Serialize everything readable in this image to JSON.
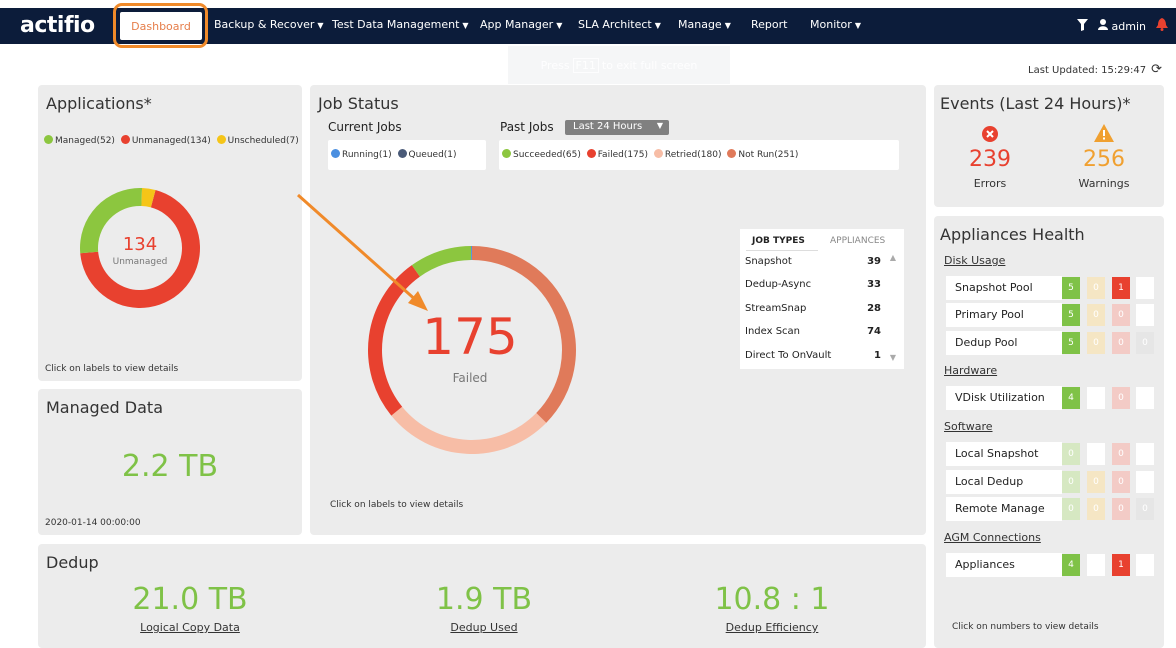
{
  "nav": {
    "logo": "actifio",
    "items": {
      "dashboard": "Dashboard",
      "backup": "Backup & Recover",
      "tdm": "Test Data Management",
      "app_manager": "App Manager",
      "sla": "SLA Architect",
      "manage": "Manage",
      "report": "Report",
      "monitor": "Monitor"
    },
    "user": "admin"
  },
  "fullscreen_tip": {
    "pre": "Press",
    "key": "F11",
    "post": "to exit full screen"
  },
  "last_updated": "Last Updated: 15:29:47",
  "applications": {
    "title": "Applications*",
    "legend": [
      {
        "label": "Managed(52)",
        "color": "#8cc63f"
      },
      {
        "label": "Unmanaged(134)",
        "color": "#e8412f"
      },
      {
        "label": "Unscheduled(7)",
        "color": "#f5c518"
      }
    ],
    "center_value": "134",
    "center_label": "Unmanaged",
    "hint": "Click on labels to view details"
  },
  "managed_data": {
    "title": "Managed Data",
    "value": "2.2 TB",
    "date": "2020-01-14 00:00:00"
  },
  "job_status": {
    "title": "Job Status",
    "current_title": "Current Jobs",
    "past_title": "Past Jobs",
    "past_range": "Last 24 Hours",
    "current_legend": [
      {
        "label": "Running(1)",
        "color": "#4a8fe0"
      },
      {
        "label": "Queued(1)",
        "color": "#4a5a78"
      }
    ],
    "past_legend": [
      {
        "label": "Succeeded(65)",
        "color": "#8cc63f"
      },
      {
        "label": "Failed(175)",
        "color": "#e8412f"
      },
      {
        "label": "Retried(180)",
        "color": "#f7bda6"
      },
      {
        "label": "Not Run(251)",
        "color": "#e07a5a"
      }
    ],
    "center_value": "175",
    "center_label": "Failed",
    "hint": "Click on labels to view details"
  },
  "job_types": {
    "tab_types": "JOB TYPES",
    "tab_appliances": "APPLIANCES",
    "rows": [
      {
        "name": "Snapshot",
        "value": "39"
      },
      {
        "name": "Dedup-Async",
        "value": "33"
      },
      {
        "name": "StreamSnap",
        "value": "28"
      },
      {
        "name": "Index Scan",
        "value": "74"
      },
      {
        "name": "Direct To OnVault",
        "value": "1"
      }
    ]
  },
  "dedup": {
    "title": "Dedup",
    "logical_value": "21.0 TB",
    "logical_label": "Logical Copy Data",
    "used_value": "1.9 TB",
    "used_label": "Dedup Used",
    "eff_value": "10.8 : 1",
    "eff_label": "Dedup Efficiency"
  },
  "events": {
    "title": "Events (Last 24 Hours)*",
    "errors": "239",
    "errors_label": "Errors",
    "warnings": "256",
    "warnings_label": "Warnings"
  },
  "health": {
    "title": "Appliances Health",
    "disk_usage": "Disk Usage",
    "hardware": "Hardware",
    "software": "Software",
    "agm": "AGM Connections",
    "rows": {
      "snapshot_pool": {
        "label": "Snapshot Pool",
        "c1": "5",
        "c2": "0",
        "c3": "1",
        "c4": ""
      },
      "primary_pool": {
        "label": "Primary Pool",
        "c1": "5",
        "c2": "0",
        "c3": "0",
        "c4": ""
      },
      "dedup_pool": {
        "label": "Dedup Pool",
        "c1": "5",
        "c2": "0",
        "c3": "0",
        "c4": "0"
      },
      "vdisk": {
        "label": "VDisk Utilization",
        "c1": "4",
        "c2": "",
        "c3": "0",
        "c4": ""
      },
      "local_snapshot": {
        "label": "Local Snapshot",
        "c1": "0",
        "c2": "",
        "c3": "0",
        "c4": ""
      },
      "local_dedup": {
        "label": "Local Dedup",
        "c1": "0",
        "c2": "0",
        "c3": "0",
        "c4": ""
      },
      "remote_manage": {
        "label": "Remote Manage",
        "c1": "0",
        "c2": "0",
        "c3": "0",
        "c4": "0"
      },
      "appliances": {
        "label": "Appliances",
        "c1": "4",
        "c2": "",
        "c3": "1",
        "c4": ""
      }
    },
    "hint": "Click on numbers to view details"
  },
  "colors": {
    "green": "#7fc247",
    "red": "#e8412f",
    "orange": "#f0a030",
    "light_green": "#d6e8c2",
    "light_yellow": "#f5e6c4",
    "light_red": "#f3cbc6",
    "light_gray": "#e6e6e6"
  }
}
